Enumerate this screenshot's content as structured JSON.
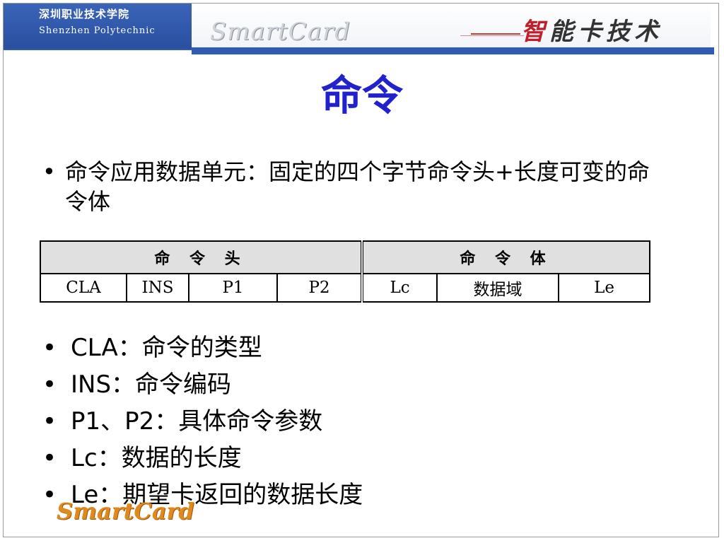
{
  "header": {
    "school_cn": "深圳职业技术学院",
    "school_en": "Shenzhen Polytechnic",
    "brand_logo": "SmartCard",
    "brand_cn_first": "智",
    "brand_cn_rest": "能卡技术"
  },
  "title": "命令",
  "intro": {
    "bullet": "•",
    "text": "命令应用数据单元：固定的四个字节命令头+长度可变的命令体"
  },
  "table": {
    "group_headers": [
      "命 令 头",
      "命 令 体"
    ],
    "cells": [
      "CLA",
      "INS",
      "P1",
      "P2",
      "Lc",
      "数据域",
      "Le"
    ]
  },
  "fields": [
    {
      "bullet": "•",
      "text": "CLA：命令的类型"
    },
    {
      "bullet": "•",
      "text": "INS：命令编码"
    },
    {
      "bullet": "•",
      "text": "P1、P2：具体命令参数"
    },
    {
      "bullet": "•",
      "text": "Lc：数据的长度"
    },
    {
      "bullet": "•",
      "text": "Le：期望卡返回的数据长度"
    }
  ],
  "footer": {
    "logo": "SmartCard"
  },
  "colors": {
    "title": "#2222cc",
    "header_blue": "#2f5bb4",
    "footer_logo": "#e08a1e",
    "brand_red": "#c0202a"
  }
}
